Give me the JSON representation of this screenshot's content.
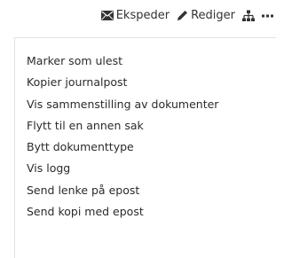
{
  "toolbar": {
    "expedite_label": "Ekspeder",
    "expedite_icon": "envelope-icon",
    "edit_label": "Rediger",
    "edit_icon": "pencil-icon",
    "hierarchy_icon": "sitemap-icon",
    "more_icon": "ellipsis-icon"
  },
  "menu": {
    "items": [
      {
        "label": "Marker som ulest"
      },
      {
        "label": "Kopier journalpost"
      },
      {
        "label": "Vis sammenstilling av dokumenter"
      },
      {
        "label": "Flytt til en annen sak"
      },
      {
        "label": "Bytt dokumenttype"
      },
      {
        "label": "Vis logg"
      },
      {
        "label": "Send lenke på epost"
      },
      {
        "label": "Send kopi med epost"
      }
    ]
  }
}
